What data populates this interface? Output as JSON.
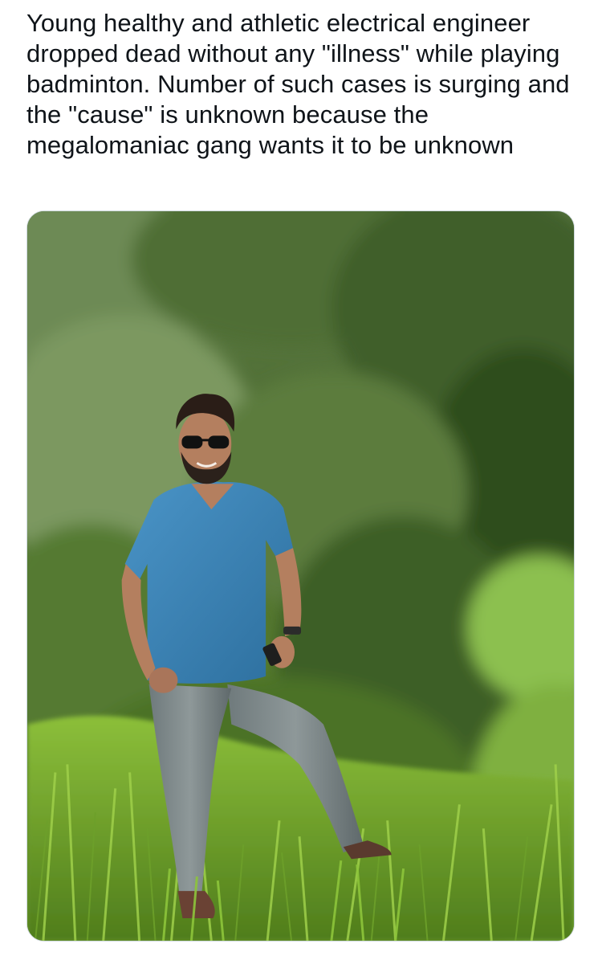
{
  "post": {
    "text": "Young healthy and athletic electrical engineer dropped dead without any \"illness\" while playing badminton. Number of such cases is surging and the \"cause\" is unknown because the megalomaniac gang wants it to be unknown"
  },
  "media": {
    "type": "photo"
  },
  "colors": {
    "text": "#0f1419",
    "card_border": "#cfd9de",
    "background": "#ffffff"
  }
}
